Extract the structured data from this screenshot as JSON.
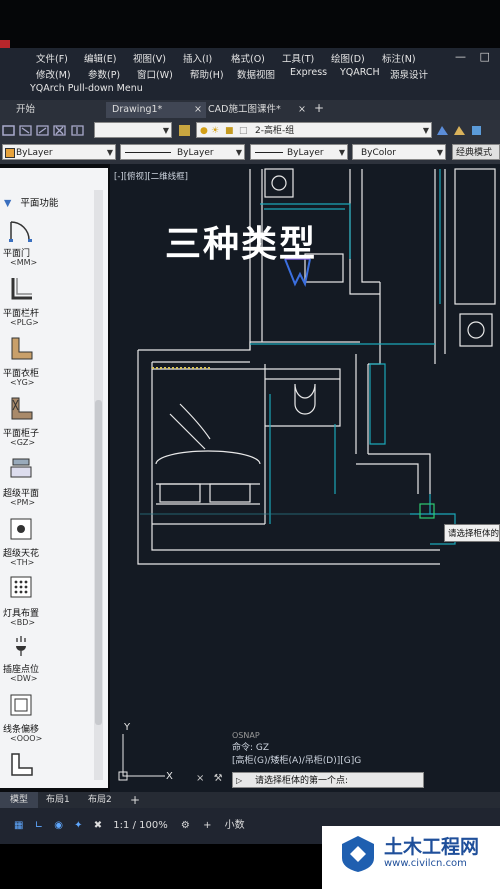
{
  "menu": {
    "row1": [
      "文件(F)",
      "编辑(E)",
      "视图(V)",
      "插入(I)",
      "格式(O)",
      "工具(T)",
      "绘图(D)",
      "标注(N)"
    ],
    "row2": [
      "修改(M)",
      "参数(P)",
      "窗口(W)",
      "帮助(H)",
      "数据视图",
      "Express",
      "YQARCH",
      "源泉设计"
    ],
    "row3": "YQArch Pull-down Menu"
  },
  "tabs": [
    {
      "label": "开始"
    },
    {
      "label": "Drawing1*"
    },
    {
      "label": "CAD施工图课件*"
    }
  ],
  "toolbar": {
    "layer": "2-高柜-组",
    "color": "ByLayer",
    "linetype": "ByLayer",
    "lineweight": "ByLayer",
    "plotstyle": "ByColor",
    "workspace": "经典模式"
  },
  "palette": {
    "section": "平面功能",
    "items": [
      {
        "label": "平面门",
        "code": "<MM>"
      },
      {
        "label": "平面栏杆",
        "code": "<PLG>"
      },
      {
        "label": "平面衣柜",
        "code": "<YG>"
      },
      {
        "label": "平面柜子",
        "code": "<GZ>"
      },
      {
        "label": "超级平面",
        "code": "<PM>"
      },
      {
        "label": "超级天花",
        "code": "<TH>"
      },
      {
        "label": "灯具布置",
        "code": "<BD>"
      },
      {
        "label": "插座点位",
        "code": "<DW>"
      },
      {
        "label": "线条偏移",
        "code": "<OOO>"
      }
    ]
  },
  "canvas": {
    "view_label": "[-][俯视][二维线框]",
    "overlay_title": "三种类型",
    "tooltip": "请选择柜体的"
  },
  "command": {
    "osnap": "OSNAP",
    "line1": "命令: GZ",
    "line2": "[高柜(G)/矮柜(A)/吊柜(D)][G]G",
    "prompt": "请选择柜体的第一个点:"
  },
  "layout_tabs": [
    "模型",
    "布局1",
    "布局2"
  ],
  "status": {
    "scale": "1:1 / 100%",
    "units": "小数"
  },
  "watermark": {
    "name": "土木工程网",
    "url": "www.civilcn.com"
  }
}
